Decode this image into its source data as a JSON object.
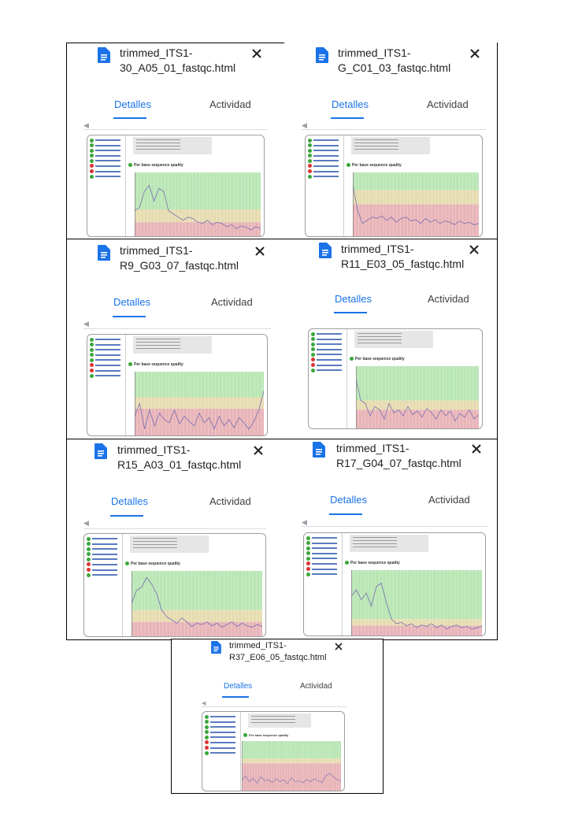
{
  "panels": [
    {
      "id": "p1",
      "title_line1": "trimmed_ITS1-",
      "title_line2": "30_A05_01_fastqc.html",
      "tab_details": "Detalles",
      "tab_activity": "Actividad",
      "active_tab": "Detalles",
      "report_heading": "Per base sequence quality"
    },
    {
      "id": "p2",
      "title_line1": "trimmed_ITS1-",
      "title_line2": "G_C01_03_fastqc.html",
      "tab_details": "Detalles",
      "tab_activity": "Actividad",
      "active_tab": "Detalles",
      "report_heading": "Per base sequence quality"
    },
    {
      "id": "p3",
      "title_line1": "trimmed_ITS1-",
      "title_line2": "R9_G03_07_fastqc.html",
      "tab_details": "Detalles",
      "tab_activity": "Actividad",
      "active_tab": "Detalles",
      "report_heading": "Per base sequence quality"
    },
    {
      "id": "p4",
      "title_line1": "trimmed_ITS1-",
      "title_line2": "R11_E03_05_fastqc.html",
      "tab_details": "Detalles",
      "tab_activity": "Actividad",
      "active_tab": "Detalles",
      "report_heading": "Per base sequence quality"
    },
    {
      "id": "p5",
      "title_line1": "trimmed_ITS1-",
      "title_line2": "R15_A03_01_fastqc.html",
      "tab_details": "Detalles",
      "tab_activity": "Actividad",
      "active_tab": "Detalles",
      "report_heading": "Per base sequence quality"
    },
    {
      "id": "p6",
      "title_line1": "trimmed_ITS1-",
      "title_line2": "R17_G04_07_fastqc.html",
      "tab_details": "Detalles",
      "tab_activity": "Actividad",
      "active_tab": "Detalles",
      "report_heading": "Per base sequence quality"
    },
    {
      "id": "p7",
      "title_line1": "trimmed_ITS1-",
      "title_line2": "R37_E06_05_fastqc.html",
      "tab_details": "Detalles",
      "tab_activity": "Actividad",
      "active_tab": "Detalles",
      "report_heading": "Per base sequence quality"
    }
  ],
  "icons": {
    "file": "document-icon",
    "close": "close-icon",
    "back": "chevron-left-icon",
    "pass": "check-circle-icon",
    "fail": "cross-circle-icon"
  },
  "colors": {
    "accent": "#1a73e8",
    "doc_icon": "#1a73e8",
    "zone_good": "#b9e6b4",
    "zone_warn": "#e6dcb0",
    "zone_bad": "#e8b4b8",
    "quality_line": "#7a6fb0"
  }
}
